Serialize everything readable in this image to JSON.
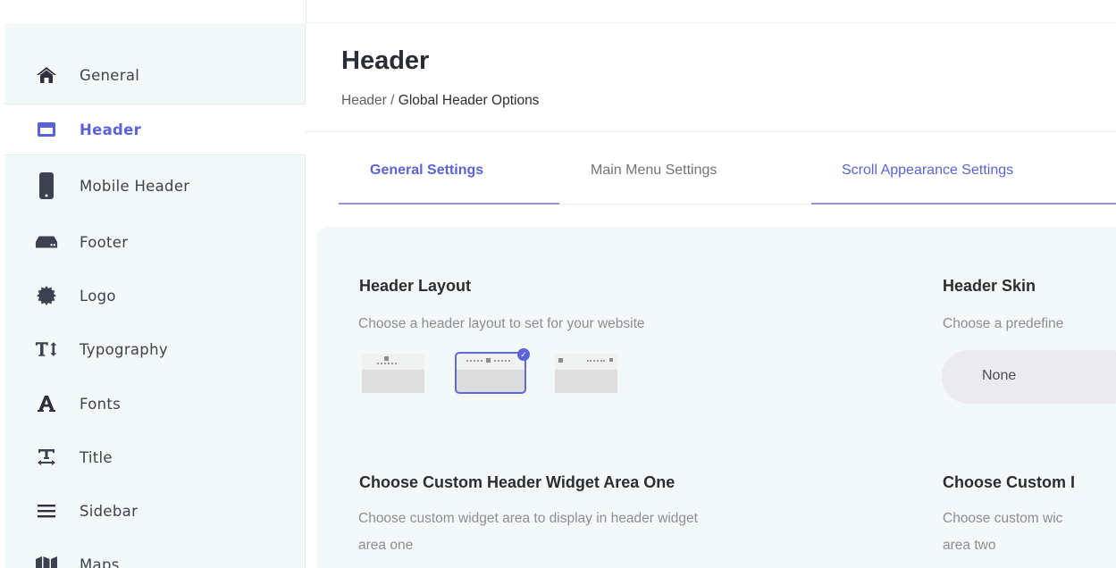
{
  "sidebar": {
    "items": [
      {
        "label": "General",
        "icon": "home-icon"
      },
      {
        "label": "Header",
        "icon": "window-icon",
        "active": true
      },
      {
        "label": "Mobile Header",
        "icon": "mobile-icon"
      },
      {
        "label": "Footer",
        "icon": "hdd-icon"
      },
      {
        "label": "Logo",
        "icon": "certificate-icon"
      },
      {
        "label": "Typography",
        "icon": "text-height-icon"
      },
      {
        "label": "Fonts",
        "icon": "font-icon"
      },
      {
        "label": "Title",
        "icon": "text-width-icon"
      },
      {
        "label": "Sidebar",
        "icon": "bars-icon"
      },
      {
        "label": "Maps",
        "icon": "map-icon"
      }
    ]
  },
  "header": {
    "title": "Header",
    "breadcrumb_root": "Header",
    "breadcrumb_sep": " / ",
    "breadcrumb_current": "Global Header Options"
  },
  "tabs": [
    {
      "label": "General Settings",
      "active": true
    },
    {
      "label": "Main Menu Settings",
      "active": false
    },
    {
      "label": "Scroll Appearance Settings",
      "active": true
    }
  ],
  "sections": {
    "header_layout": {
      "title": "Header Layout",
      "desc": "Choose a header layout to set for your website",
      "selected_index": 1
    },
    "header_skin": {
      "title": "Header Skin",
      "desc": "Choose a predefine",
      "value": "None"
    },
    "widget_one": {
      "title": "Choose Custom Header Widget Area One",
      "desc_line1": "Choose custom widget area to display in header widget",
      "desc_line2": "area one"
    },
    "widget_two": {
      "title": "Choose Custom I",
      "desc_line1": "Choose custom wic",
      "desc_line2": "area two"
    }
  },
  "colors": {
    "accent": "#5a62d8",
    "sidebar_bg": "#f3f8f8",
    "panel_bg": "#f3f8f8"
  }
}
